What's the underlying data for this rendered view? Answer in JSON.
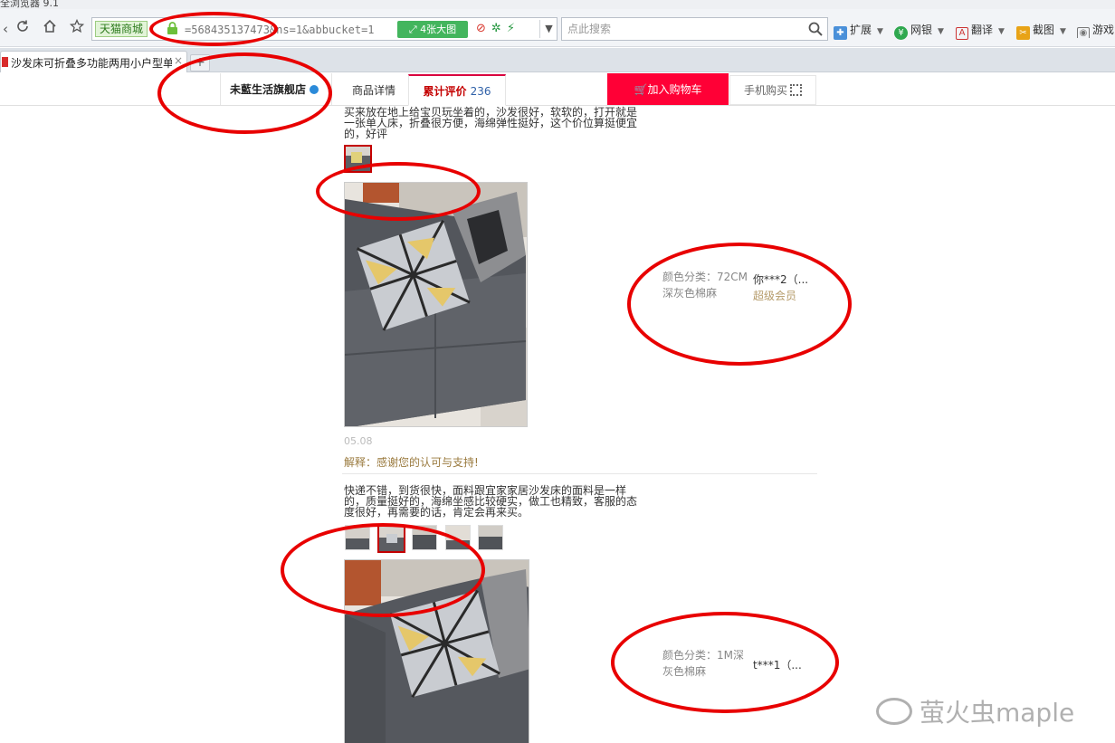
{
  "browser": {
    "title_text": "全浏览器 9.1",
    "address_bar": {
      "site_tag": "天猫商城",
      "url": "=568435137473&ns=1&abbucket=1",
      "big_pic_label": "4张大图"
    },
    "search": {
      "placeholder": "点此搜索"
    },
    "extensions": [
      {
        "icon": "puzzle-icon",
        "label": "扩展"
      },
      {
        "icon": "bank-icon",
        "label": "网银"
      },
      {
        "icon": "translate-icon",
        "label": "翻译"
      },
      {
        "icon": "screenshot-icon",
        "label": "截图"
      },
      {
        "icon": "gamepad-icon",
        "label": "游戏"
      }
    ],
    "tab": {
      "title": "沙发床可折叠多功能两用小户型单人"
    }
  },
  "store_nav": {
    "store_name": "未藍生活旗舰店",
    "tabs": [
      {
        "label": "商品详情",
        "count": ""
      },
      {
        "label": "累计评价",
        "count": "236"
      }
    ],
    "active_tab": 1,
    "cart_label": "加入购物车",
    "mobile_buy_label": "手机购买"
  },
  "reviews": [
    {
      "text": "买来放在地上给宝贝玩坐着的，沙发很好，软软的，打开就是一张单人床，折叠很方便，海绵弹性挺好，这个价位算挺便宜的，好评",
      "variant_label": "颜色分类：72CM",
      "variant_value": "深灰色棉麻",
      "user": "你***2（...",
      "badge": "超级会员",
      "date": "05.08",
      "reply": "解释：感谢您的认可与支持!"
    },
    {
      "text": "快递不错，到货很快，面料跟宜家家居沙发床的面料是一样的，质量挺好的，海绵坐感比较硬实，做工也精致，客服的态度很好，再需要的话，肯定会再来买。",
      "variant_label": "颜色分类：1M深",
      "variant_value": "灰色棉麻",
      "user": "t***1（..."
    }
  ],
  "watermark": "萤火虫maple",
  "colors": {
    "accent_red": "#ff0036",
    "annotation_red": "#e80000",
    "reply_gold": "#9a7a3e",
    "vip_gold": "#b59b6a",
    "link_blue": "#3061a8"
  }
}
